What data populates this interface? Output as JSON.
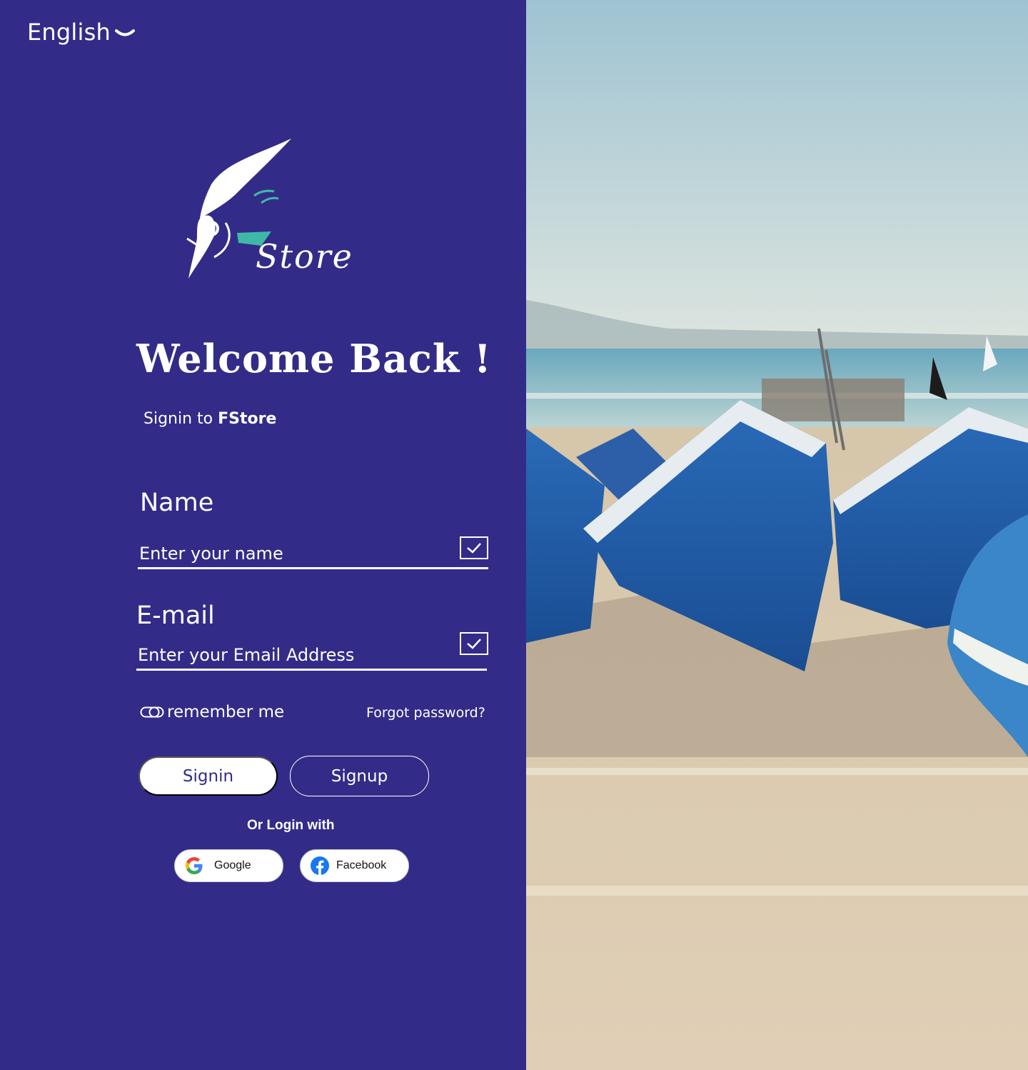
{
  "language": {
    "label": "English",
    "icon": "chevron-down-icon"
  },
  "brand": {
    "wordmark": "Store"
  },
  "welcome": {
    "title": "Welcome Back !",
    "subtitle_prefix": "Signin to ",
    "subtitle_brand": "FStore"
  },
  "form": {
    "name": {
      "label": "Name",
      "placeholder": "Enter your name",
      "value": ""
    },
    "email": {
      "label": "E-mail",
      "placeholder": "Enter your Email Address",
      "value": ""
    },
    "remember_label": "remember me",
    "forgot_label": "Forgot password?",
    "signin_label": "Signin",
    "signup_label": "Signup"
  },
  "social": {
    "or_label": "Or Login with",
    "google_label": "Google",
    "facebook_label": "Facebook"
  },
  "colors": {
    "primary": "#322c88",
    "accent": "#3fb8a8",
    "white": "#ffffff"
  }
}
